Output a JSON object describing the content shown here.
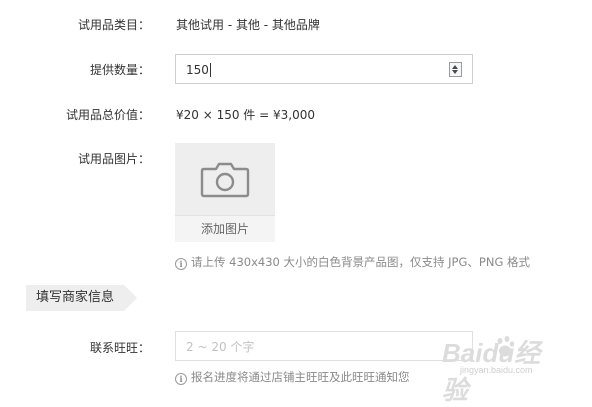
{
  "form": {
    "category": {
      "label": "试用品类目：",
      "value": "其他试用 - 其他 - 其他品牌"
    },
    "quantity": {
      "label": "提供数量：",
      "value": "150"
    },
    "total": {
      "label": "试用品总价值：",
      "value": "¥20 × 150 件 = ¥3,000"
    },
    "image": {
      "label": "试用品图片：",
      "add_label": "添加图片",
      "hint": "请上传 430x430 大小的白色背景产品图，仅支持 JPG、PNG 格式"
    }
  },
  "section": {
    "title": "填写商家信息"
  },
  "merchant": {
    "wangwang": {
      "label": "联系旺旺：",
      "placeholder": "2 ~ 20 个字",
      "hint": "报名进度将通过店铺主旺旺及此旺旺通知您"
    }
  },
  "watermark": {
    "brand": "Baidu经验",
    "url": "jingyan.baidu.com"
  },
  "icons": {
    "info": "info-icon",
    "camera": "camera-icon",
    "spinner": "spinner-icon"
  }
}
